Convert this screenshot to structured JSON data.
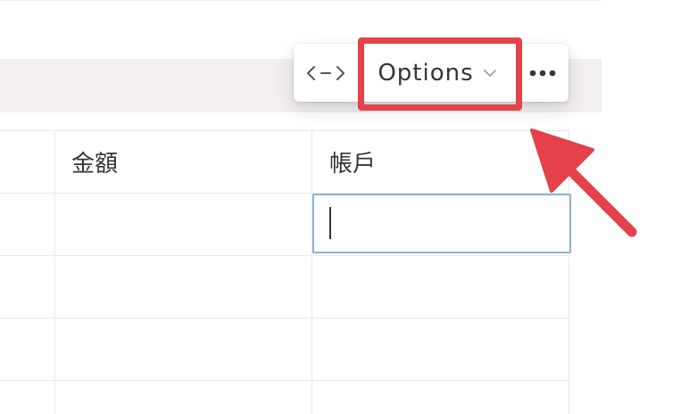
{
  "toolbar": {
    "width_icon": "↔",
    "options_label": "Options",
    "options_icon": "chevron-down-icon",
    "more_icon": "more-horizontal-icon"
  },
  "table": {
    "columns": [
      {
        "label": ""
      },
      {
        "label": "金額"
      },
      {
        "label": "帳戶"
      }
    ],
    "rows": [
      {
        "cells": [
          "",
          "",
          ""
        ]
      },
      {
        "cells": [
          "",
          "",
          ""
        ]
      },
      {
        "cells": [
          "",
          "",
          ""
        ]
      },
      {
        "cells": [
          "",
          "",
          ""
        ]
      }
    ]
  },
  "annotation": {
    "highlight_color": "#e4414a",
    "arrow_color": "#e4414a",
    "active_cell_border": "#8cb4d4"
  }
}
